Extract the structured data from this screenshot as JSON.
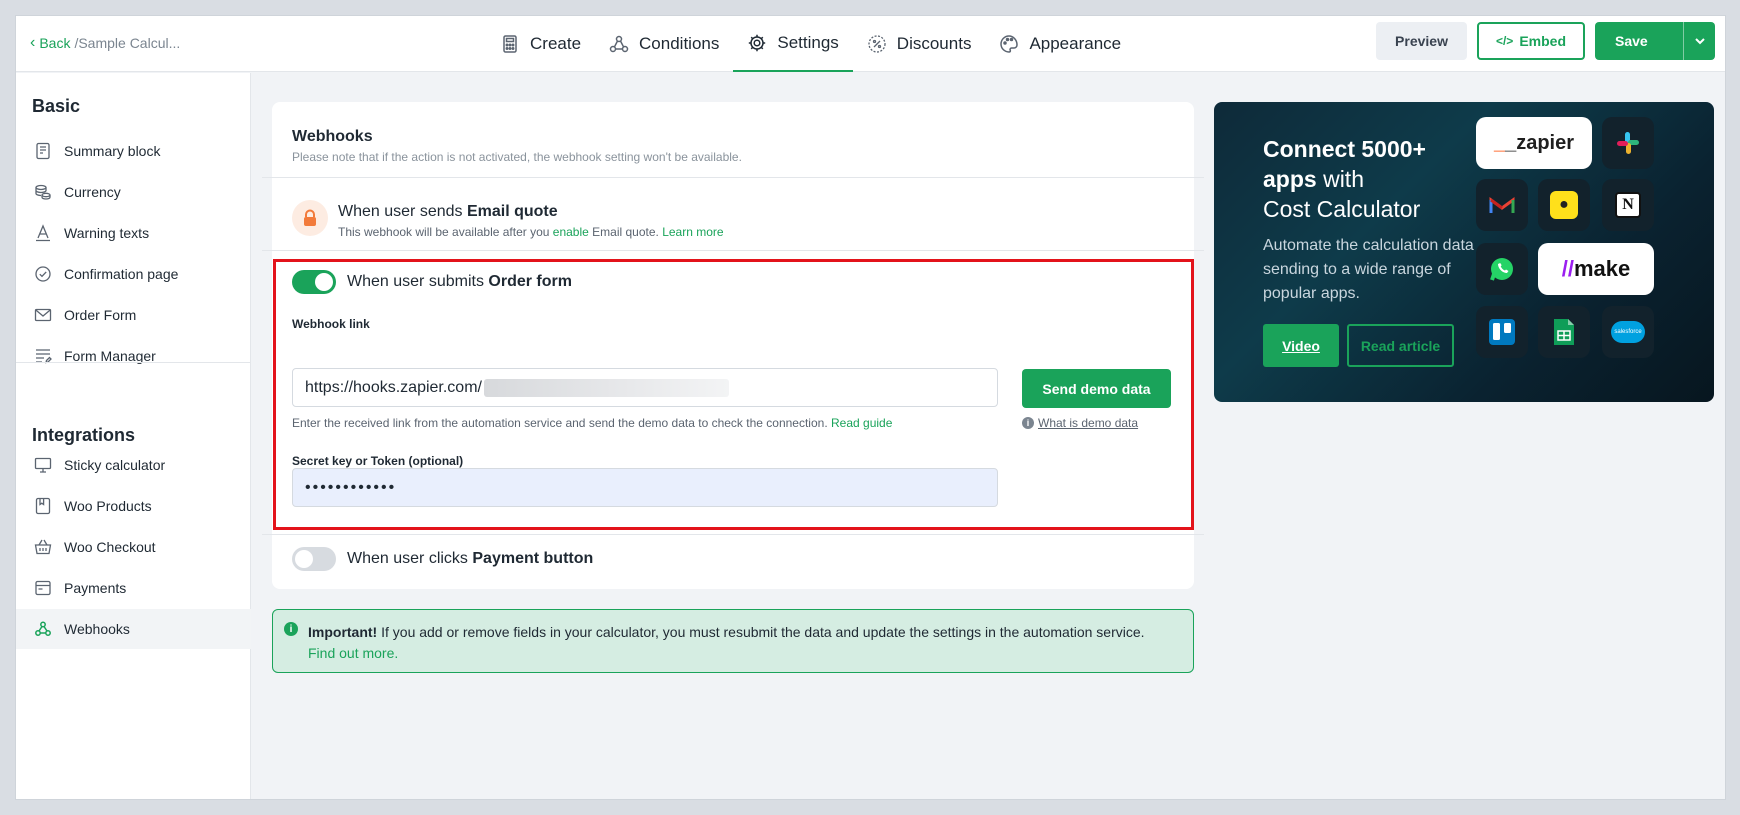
{
  "header": {
    "back_label": "Back",
    "breadcrumb": "/Sample Calcul...",
    "tabs": [
      {
        "label": "Create",
        "icon": "calculator-icon"
      },
      {
        "label": "Conditions",
        "icon": "conditions-icon"
      },
      {
        "label": "Settings",
        "icon": "gear-icon",
        "active": true
      },
      {
        "label": "Discounts",
        "icon": "percent-icon"
      },
      {
        "label": "Appearance",
        "icon": "palette-icon"
      }
    ],
    "preview_label": "Preview",
    "embed_label": "Embed",
    "save_label": "Save"
  },
  "sidebar": {
    "basic_heading": "Basic",
    "basic_items": [
      {
        "label": "Summary block",
        "icon": "summary-icon"
      },
      {
        "label": "Currency",
        "icon": "coins-icon"
      },
      {
        "label": "Warning texts",
        "icon": "text-icon"
      },
      {
        "label": "Confirmation page",
        "icon": "check-circle-icon"
      },
      {
        "label": "Order Form",
        "icon": "envelope-icon"
      },
      {
        "label": "Form Manager",
        "icon": "form-icon"
      }
    ],
    "integrations_heading": "Integrations",
    "integration_items": [
      {
        "label": "Sticky calculator",
        "icon": "monitor-icon"
      },
      {
        "label": "Woo Products",
        "icon": "bookmark-icon"
      },
      {
        "label": "Woo Checkout",
        "icon": "basket-icon"
      },
      {
        "label": "Payments",
        "icon": "card-icon"
      },
      {
        "label": "Webhooks",
        "icon": "webhook-icon",
        "active": true
      }
    ]
  },
  "webhooks": {
    "title": "Webhooks",
    "subtitle": "Please note that if the action is not activated, the webhook setting won't be available.",
    "email_quote": {
      "title_prefix": "When user sends ",
      "title_bold": "Email quote",
      "note_prefix": "This webhook will be available after you ",
      "note_enable": "enable",
      "note_mid": " Email quote. ",
      "note_link": "Learn more"
    },
    "order_form": {
      "enabled": true,
      "title_prefix": "When user submits ",
      "title_bold": "Order form",
      "webhook_link_label": "Webhook link",
      "webhook_link_value": "https://hooks.zapier.com/",
      "send_demo_label": "Send demo data",
      "hint": "Enter the received link from the automation service and send the demo data to check the connection.",
      "read_guide": "Read guide",
      "what_is_demo": "What is demo data",
      "secret_label": "Secret key or Token (optional)",
      "secret_value": "••••••••••••"
    },
    "payment_button": {
      "enabled": false,
      "title_prefix": "When user clicks ",
      "title_bold": "Payment button"
    }
  },
  "notice": {
    "bold": "Important!",
    "text": " If you add or remove fields in your calculator, you must resubmit the data and update the settings in the automation service.",
    "link": "Find out more."
  },
  "promo": {
    "title_line1": "Connect 5000+",
    "title_bold2": "apps",
    "title_rest2": " with",
    "title_line3": "Cost Calculator",
    "text": "Automate the calculation data sending to a wide range of popular apps.",
    "video_label": "Video",
    "read_label": "Read article",
    "logos": {
      "zapier": "_zapier",
      "make": "make",
      "salesforce": "salesforce"
    }
  },
  "colors": {
    "accent": "#1aa35a",
    "highlight": "#e3131b",
    "promo_bg": "#0e2a39"
  }
}
